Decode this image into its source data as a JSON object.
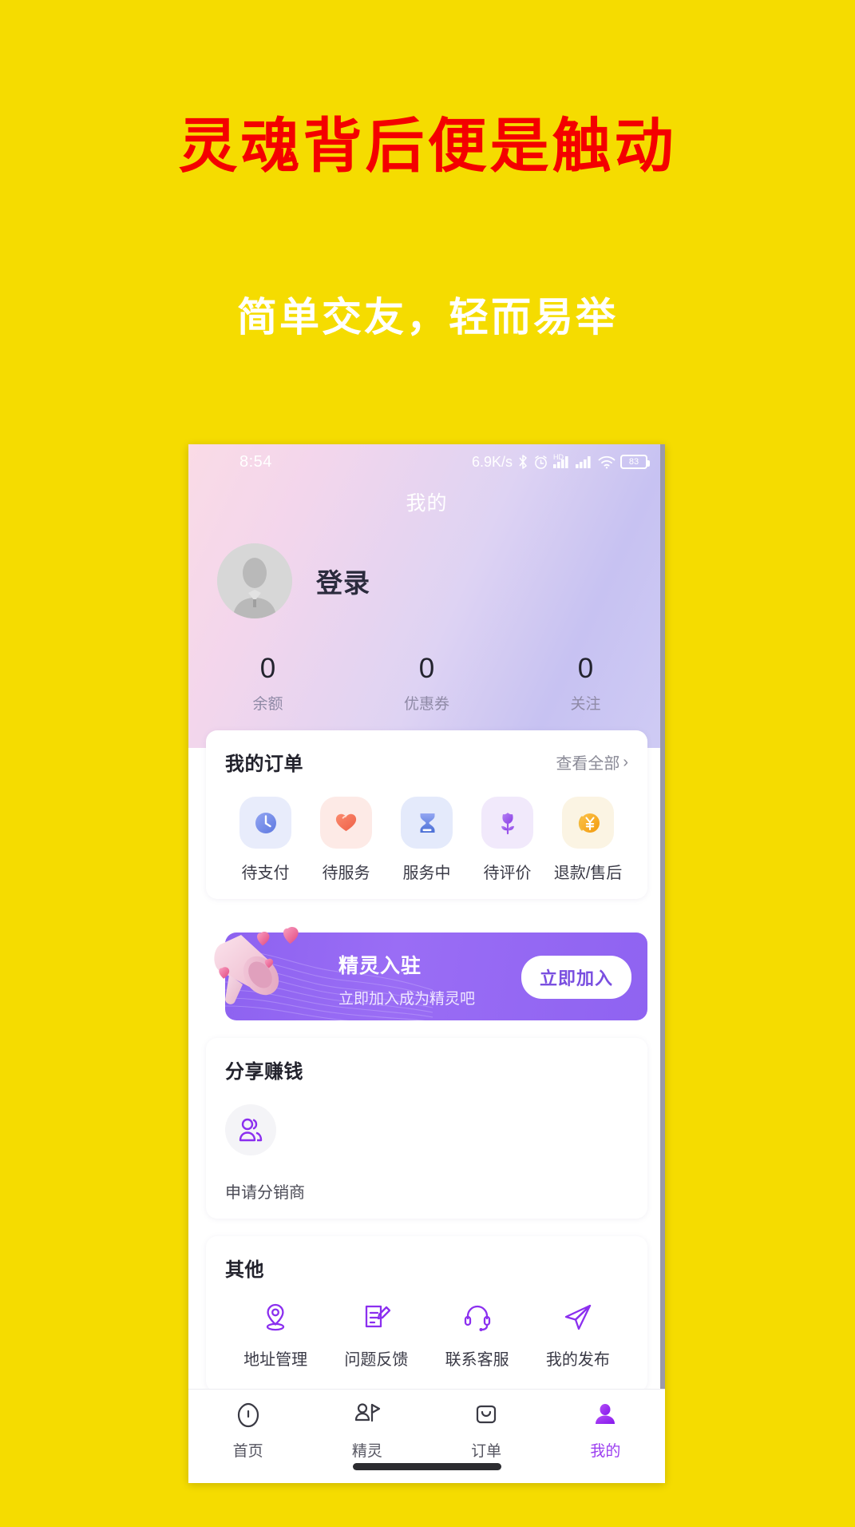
{
  "promo": {
    "headline": "灵魂背后便是触动",
    "subhead": "简单交友，轻而易举",
    "headline_color": "#f40000",
    "background_color": "#f5dc00"
  },
  "statusbar": {
    "time": "8:54",
    "net_speed": "6.9K/s",
    "bluetooth_icon": "bluetooth-icon",
    "alarm_icon": "alarm-icon",
    "hd_label": "HD",
    "signal1_icon": "signal-bars-icon",
    "signal2_icon": "signal-bars-icon",
    "wifi_icon": "wifi-icon",
    "battery_level": "83"
  },
  "nav": {
    "title": "我的"
  },
  "profile": {
    "avatar_icon": "default-avatar-icon",
    "login_label": "登录",
    "stats": [
      {
        "value": "0",
        "label": "余额"
      },
      {
        "value": "0",
        "label": "优惠券"
      },
      {
        "value": "0",
        "label": "关注"
      }
    ]
  },
  "orders": {
    "title": "我的订单",
    "see_all": "查看全部",
    "chevron": "›",
    "items": [
      {
        "label": "待支付",
        "icon": "clock-icon",
        "bg": "#e8ecfb",
        "color": "#6f86e8"
      },
      {
        "label": "待服务",
        "icon": "heart-icon",
        "bg": "#fdeae6",
        "color": "#f2705a"
      },
      {
        "label": "服务中",
        "icon": "hourglass-icon",
        "bg": "#e4eafb",
        "color": "#5f86e0"
      },
      {
        "label": "待评价",
        "icon": "tulip-icon",
        "bg": "#f1e9fb",
        "color": "#9b5ce8"
      },
      {
        "label": "退款/售后",
        "icon": "yen-coin-icon",
        "bg": "#fbf4e3",
        "color": "#f6a821"
      }
    ]
  },
  "banner": {
    "title": "精灵入驻",
    "subtitle": "立即加入成为精灵吧",
    "button": "立即加入",
    "illustration_icon": "megaphone-hearts-icon",
    "bg_color": "#8f63f1",
    "button_text_color": "#7a4fe0"
  },
  "share": {
    "title": "分享赚钱",
    "items": [
      {
        "label": "申请分销商",
        "icon": "two-people-icon"
      }
    ]
  },
  "other": {
    "title": "其他",
    "items": [
      {
        "label": "地址管理",
        "icon": "location-pin-icon"
      },
      {
        "label": "问题反馈",
        "icon": "feedback-form-icon"
      },
      {
        "label": "联系客服",
        "icon": "headset-icon"
      },
      {
        "label": "我的发布",
        "icon": "paper-plane-icon"
      }
    ]
  },
  "tabbar": {
    "accent_color": "#9b3df0",
    "items": [
      {
        "label": "首页",
        "icon": "home-icon",
        "active": false
      },
      {
        "label": "精灵",
        "icon": "sprite-flag-icon",
        "active": false
      },
      {
        "label": "订单",
        "icon": "bag-icon",
        "active": false
      },
      {
        "label": "我的",
        "icon": "person-icon",
        "active": true
      }
    ]
  }
}
